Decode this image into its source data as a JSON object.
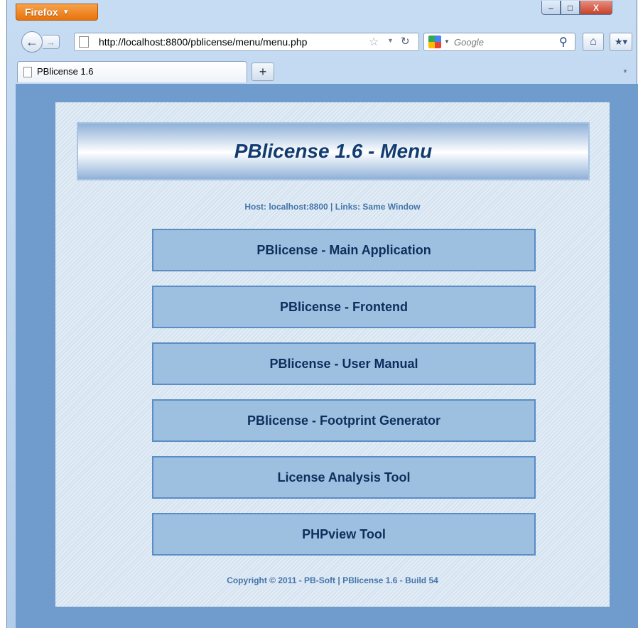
{
  "browser": {
    "app_button_label": "Firefox",
    "window_controls": {
      "minimize": "–",
      "maximize": "□",
      "close": "X"
    },
    "nav": {
      "back_icon": "back-arrow-icon",
      "forward_icon": "forward-arrow-icon",
      "url": "http://localhost:8800/pblicense/menu/menu.php",
      "search_engine": "Google",
      "search_placeholder": "Google"
    },
    "tabs": [
      {
        "label": "PBlicense 1.6",
        "active": true
      }
    ],
    "new_tab_label": "+"
  },
  "page": {
    "title": "PBlicense 1.6 - Menu",
    "host_line": "Host: localhost:8800  |  Links: Same Window",
    "menu_items": [
      {
        "label": "PBlicense - Main Application"
      },
      {
        "label": "PBlicense - Frontend"
      },
      {
        "label": "PBlicense - User Manual"
      },
      {
        "label": "PBlicense - Footprint Generator"
      },
      {
        "label": "License Analysis Tool"
      },
      {
        "label": "PHPview Tool"
      }
    ],
    "footer": "Copyright © 2011 - PB-Soft  |  PBlicense 1.6 - Build 54"
  },
  "colors": {
    "content_background": "#6f9ccc",
    "panel_background": "#d6e4f1",
    "menu_button_fill": "#9dbfe0",
    "menu_button_border": "#5a8dc4",
    "title_text": "#123c71",
    "info_text": "#4575aa",
    "firefox_button": "#e8730c"
  }
}
